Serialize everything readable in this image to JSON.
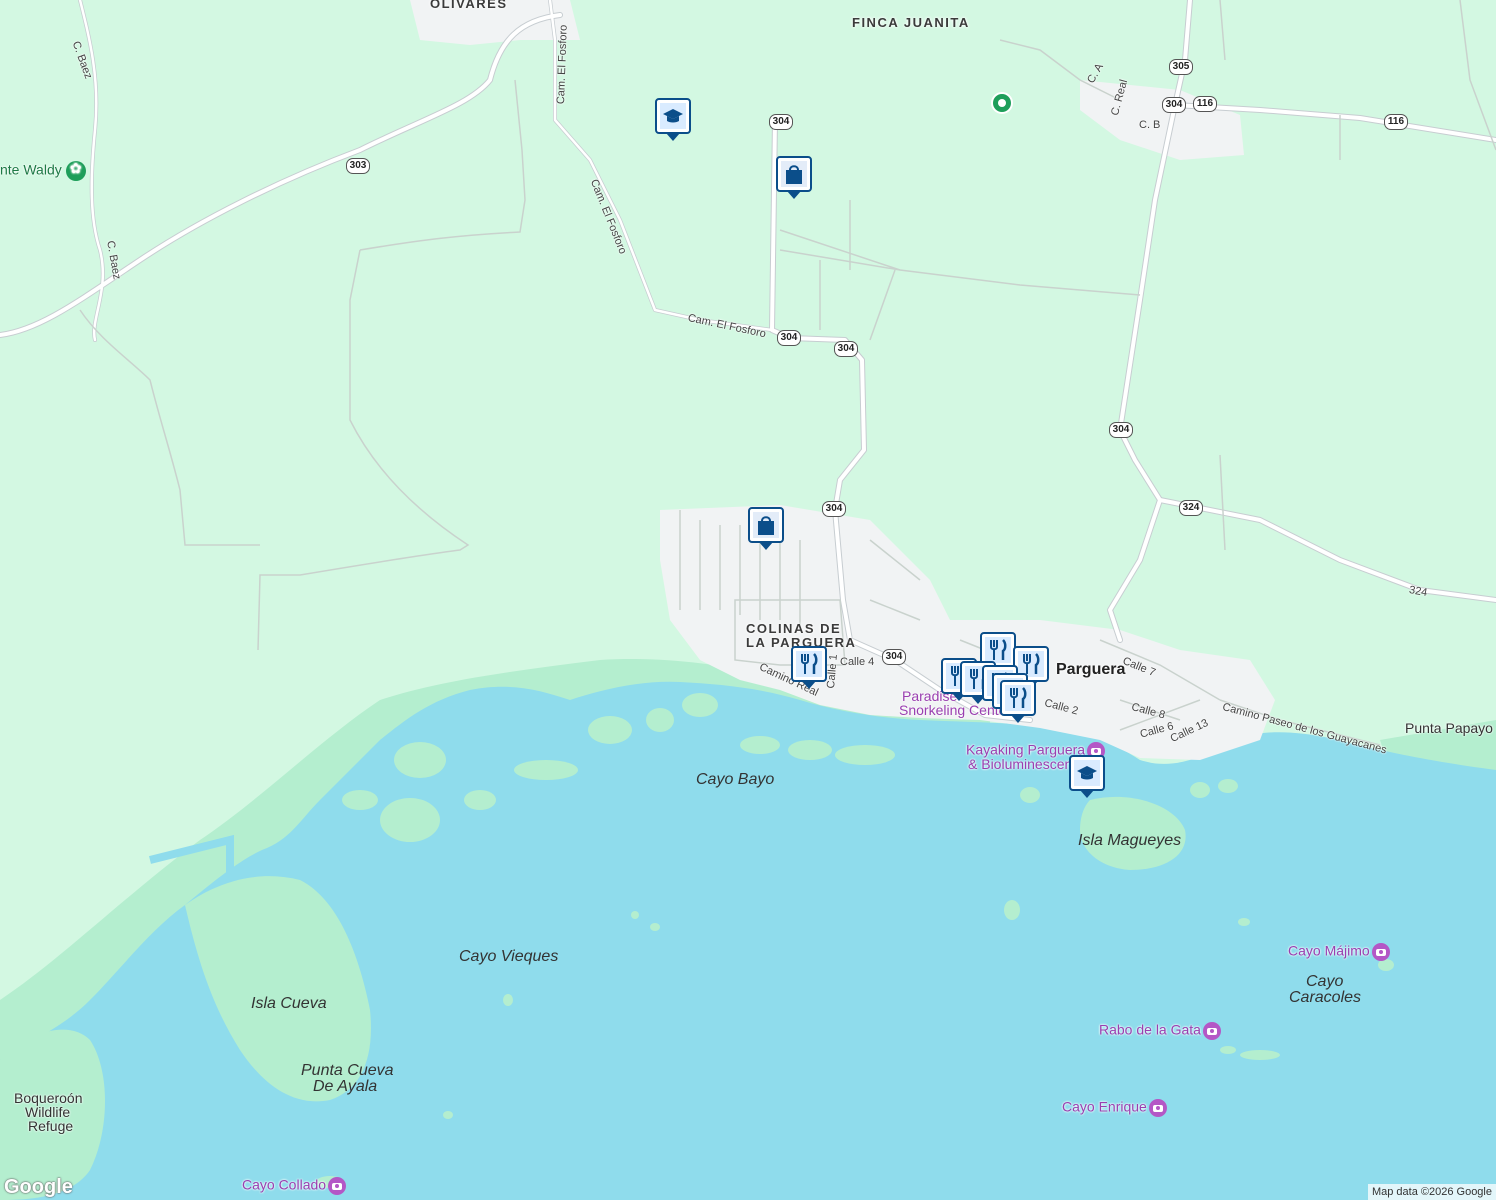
{
  "map": {
    "colors": {
      "land": "#d3f8e2",
      "water": "#8fdcec",
      "reef": "#b4eecf",
      "urban": "#f1f3f4",
      "road": "#ffffff",
      "road_edge": "#c7cdd1",
      "poi_marker": "#0b4e8a",
      "poi_purple": "#9a3fb0",
      "park_green": "#1e9e5a"
    },
    "place_labels": [
      {
        "text": "OLIVARES"
      },
      {
        "text": "FINCA JUANITA"
      },
      {
        "text": "COLINAS DE"
      },
      {
        "text": "LA PARGUERA"
      },
      {
        "text": "Parguera"
      },
      {
        "text": "Punta Papayo"
      }
    ],
    "water_labels": [
      {
        "text": "Cayo Bayo"
      },
      {
        "text": "Cayo Vieques"
      },
      {
        "text": "Isla Magueyes"
      },
      {
        "text": "Isla Cueva"
      },
      {
        "text": "Punta Cueva"
      },
      {
        "text": "De Ayala"
      },
      {
        "text": "Cayo"
      },
      {
        "text": "Caracoles"
      }
    ],
    "poi_labels": [
      {
        "text": "Paradise",
        "icon": ""
      },
      {
        "text": "Snorkeling Center",
        "icon": ""
      },
      {
        "text": "Kayaking Parguera",
        "icon": "camera-icon"
      },
      {
        "text": "& Bioluminescent Bay",
        "icon": ""
      },
      {
        "text": "Cayo Májimo",
        "icon": "camera-icon"
      },
      {
        "text": "Rabo de la Gata",
        "icon": "camera-icon"
      },
      {
        "text": "Cayo Enrique",
        "icon": "camera-icon"
      },
      {
        "text": "Cayo Collado",
        "icon": "camera-icon"
      },
      {
        "text": "nte Waldy",
        "icon": "flower-icon"
      },
      {
        "text": "Boqueroón",
        "icon": ""
      },
      {
        "text": "Wildlife",
        "icon": ""
      },
      {
        "text": "Refuge",
        "icon": ""
      }
    ],
    "road_labels": [
      {
        "text": "C. Baez"
      },
      {
        "text": "C. Baez"
      },
      {
        "text": "Cam. El Fosforo"
      },
      {
        "text": "Cam. El Fosforo"
      },
      {
        "text": "Cam. El Fosforo"
      },
      {
        "text": "C. A"
      },
      {
        "text": "C. Real"
      },
      {
        "text": "C. B"
      },
      {
        "text": "Calle 4"
      },
      {
        "text": "Calle 1"
      },
      {
        "text": "Camino Real"
      },
      {
        "text": "Calle 7"
      },
      {
        "text": "Calle 2"
      },
      {
        "text": "Calle 8"
      },
      {
        "text": "Calle 6"
      },
      {
        "text": "Calle 13"
      },
      {
        "text": "Camino Paseo de los Guayacanes"
      },
      {
        "text": "324"
      }
    ],
    "route_shields": [
      "303",
      "304",
      "304",
      "304",
      "304",
      "304",
      "304",
      "305",
      "304",
      "116",
      "116",
      "324",
      "304"
    ],
    "markers": [
      {
        "type": "school",
        "icon": "graduation-cap-icon"
      },
      {
        "type": "shopping",
        "icon": "shopping-bag-icon"
      },
      {
        "type": "shopping",
        "icon": "shopping-bag-icon"
      },
      {
        "type": "restaurant",
        "icon": "fork-knife-icon"
      },
      {
        "type": "restaurant",
        "icon": "fork-knife-icon"
      },
      {
        "type": "restaurant",
        "icon": "fork-knife-icon"
      },
      {
        "type": "restaurant",
        "icon": "fork-knife-icon"
      },
      {
        "type": "restaurant",
        "icon": "fork-knife-icon"
      },
      {
        "type": "restaurant",
        "icon": "fork-knife-icon"
      },
      {
        "type": "restaurant",
        "icon": "fork-knife-icon"
      },
      {
        "type": "restaurant",
        "icon": "fork-knife-icon"
      },
      {
        "type": "school",
        "icon": "graduation-cap-icon"
      }
    ]
  },
  "branding": {
    "logo": "Google",
    "attribution": "Map data ©2026 Google"
  }
}
